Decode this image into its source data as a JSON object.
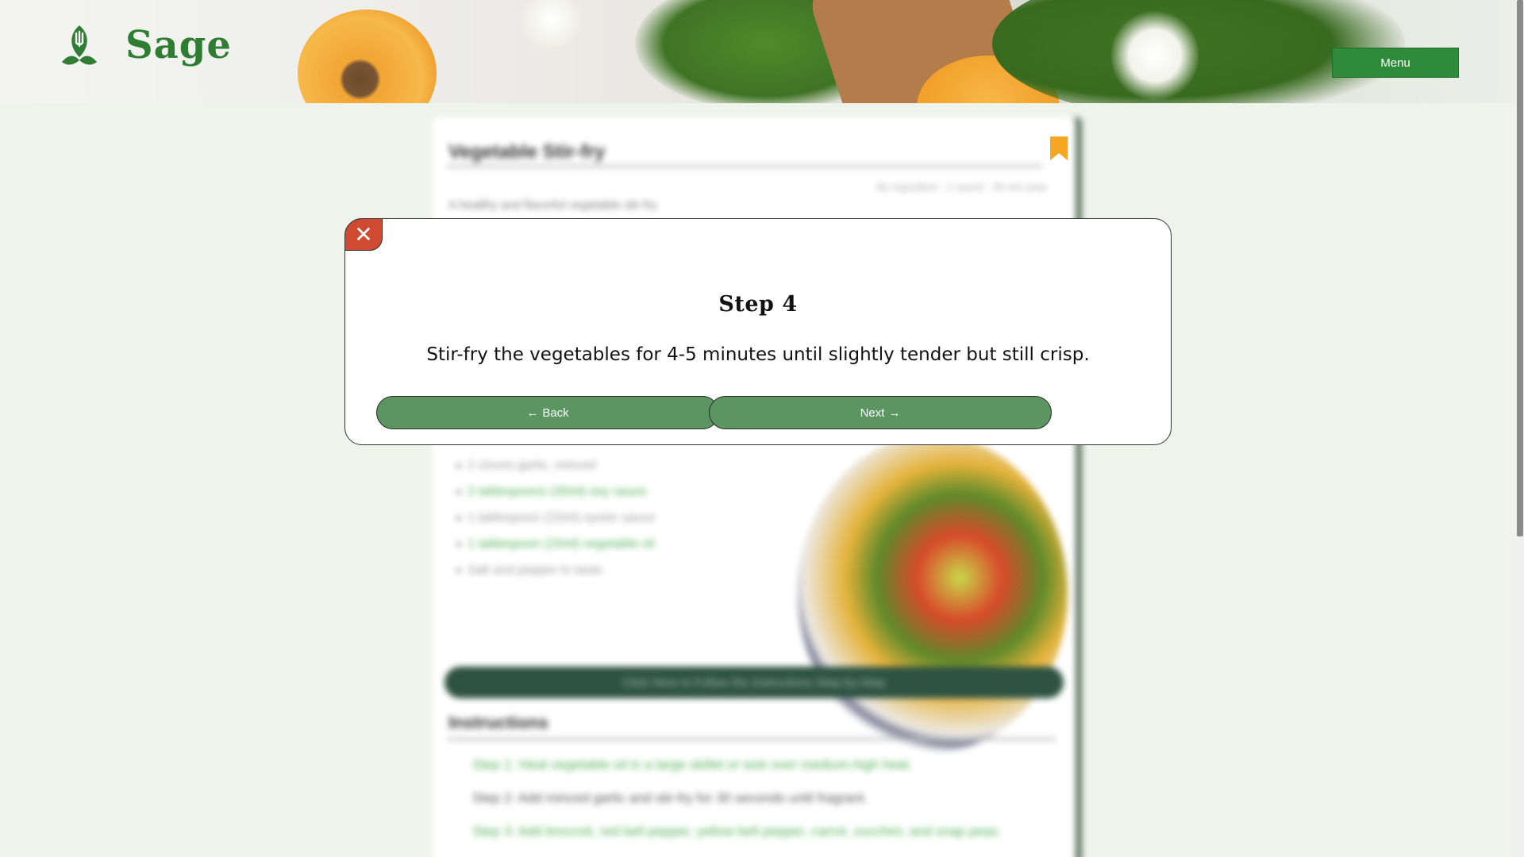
{
  "header": {
    "logo_text": "Sage",
    "menu_label": "Menu"
  },
  "card": {
    "title": "Vegetable Stir-fry",
    "meta": "By Ingredient · 2 saved · 30 min prep",
    "description": "A healthy and flavorful vegetable stir-fry",
    "ingredients": [
      {
        "label": "2 cloves garlic, minced",
        "color": "#9a9a9a"
      },
      {
        "label": "2 tablespoons (30ml) soy sauce",
        "color": "#4caf50"
      },
      {
        "label": "1 tablespoon (15ml) oyster sauce",
        "color": "#9a9a9a"
      },
      {
        "label": "1 tablespoon (15ml) vegetable oil",
        "color": "#4caf50"
      },
      {
        "label": "Salt and pepper to taste",
        "color": "#9a9a9a"
      }
    ],
    "cta_label": "Click Here to Follow the Instructions Step-by-Step",
    "instructions_title": "Instructions",
    "instructions": [
      {
        "label": "Step 1: Heat vegetable oil in a large skillet or wok over medium-high heat.",
        "color": "#4caf50"
      },
      {
        "label": "Step 2: Add minced garlic and stir-fry for 30 seconds until fragrant.",
        "color": "#555555"
      },
      {
        "label": "Step 3: Add broccoli, red bell pepper, yellow bell pepper, carrot, zucchini, and snap peas",
        "color": "#4caf50"
      }
    ]
  },
  "modal": {
    "close_symbol": "✕",
    "title": "Step 4",
    "text": "Stir-fry the vegetables for 4-5 minutes until slightly tender but still crisp.",
    "back_label": "Back",
    "next_label": "Next",
    "back_icon": "arrow-left-icon",
    "next_icon": "arrow-right-icon"
  },
  "colors": {
    "brand_green": "#2e8b3a",
    "button_green": "#5a9562",
    "close_red": "#cf4a30",
    "bookmark": "#f5a623"
  }
}
